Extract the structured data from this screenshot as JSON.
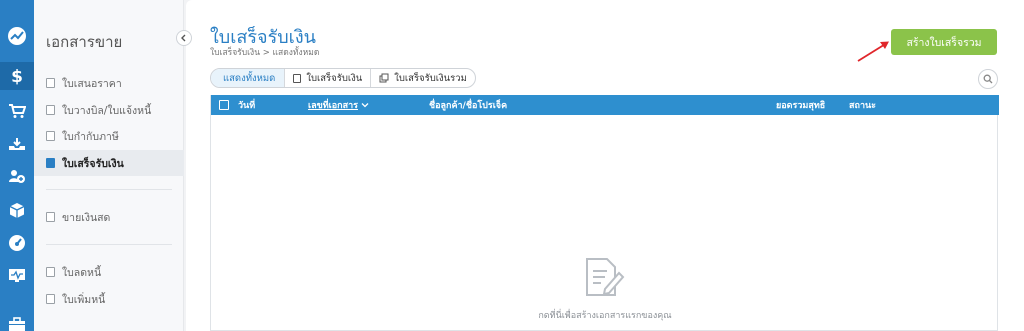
{
  "rail": {
    "items": [
      {
        "name": "dashboard-icon"
      },
      {
        "name": "sales-icon",
        "active": true
      },
      {
        "name": "cart-icon"
      },
      {
        "name": "inbox-icon"
      },
      {
        "name": "contacts-icon"
      },
      {
        "name": "box-icon"
      },
      {
        "name": "gauge-icon"
      },
      {
        "name": "monitor-icon"
      },
      {
        "name": "briefcase-icon"
      }
    ]
  },
  "sidebar": {
    "title": "เอกสารขาย",
    "items": [
      {
        "label": "ใบเสนอราคา"
      },
      {
        "label": "ใบวางบิล/ใบแจ้งหนี้"
      },
      {
        "label": "ใบกำกับภาษี"
      },
      {
        "label": "ใบเสร็จรับเงิน",
        "active": true
      },
      {
        "label": "ขายเงินสด"
      },
      {
        "label": "ใบลดหนี้"
      },
      {
        "label": "ใบเพิ่มหนี้"
      }
    ]
  },
  "header": {
    "title": "ใบเสร็จรับเงิน",
    "breadcrumb": "ใบเสร็จรับเงิน > แสดงทั้งหมด",
    "create_button": "สร้างใบเสร็จรวม"
  },
  "tabs": [
    {
      "label": "แสดงทั้งหมด",
      "active": true
    },
    {
      "label": "ใบเสร็จรับเงิน"
    },
    {
      "label": "ใบเสร็จรับเงินรวม"
    }
  ],
  "table": {
    "columns": {
      "date": "วันที่",
      "doc_no": "เลขที่เอกสาร",
      "customer": "ชื่อลูกค้า/ชื่อโปรเจ็ค",
      "total": "ยอดรวมสุทธิ",
      "status": "สถานะ"
    },
    "empty_text": "กดที่นี่เพื่อสร้างเอกสารแรกของคุณ"
  },
  "colors": {
    "accent": "#2a7fc4",
    "create_button": "#8bc34a",
    "table_header": "#2e8fcf",
    "arrow": "#e0262b"
  }
}
